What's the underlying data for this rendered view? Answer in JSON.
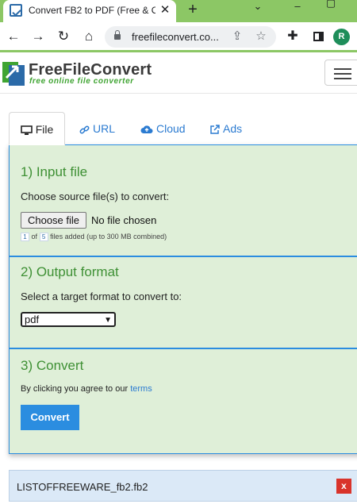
{
  "browser": {
    "tab_title": "Convert FB2 to PDF (Free & O",
    "tab_close_glyph": "✕",
    "new_tab_glyph": "+",
    "url": "freefileconvert.co...",
    "profile_initial": "R",
    "accent_color": "#8cc765"
  },
  "site": {
    "logo_name": "FreeFileConvert",
    "logo_tagline": "free online file converter",
    "menu_icon": "hamburger-icon"
  },
  "upload_tabs": [
    {
      "label": "File",
      "icon": "monitor-icon",
      "active": true
    },
    {
      "label": "URL",
      "icon": "link-icon",
      "active": false
    },
    {
      "label": "Cloud",
      "icon": "cloud-upload-icon",
      "active": false
    },
    {
      "label": "Ads",
      "icon": "external-link-icon",
      "active": false
    }
  ],
  "input_section": {
    "title": "1) Input file",
    "instruction": "Choose source file(s) to convert:",
    "choose_button": "Choose file",
    "no_file_text": "No file chosen",
    "files_added": "1",
    "files_max": "5",
    "files_note": "files added (up to 300 MB combined)",
    "of_word": "of"
  },
  "output_section": {
    "title": "2) Output format",
    "instruction": "Select a target format to convert to:",
    "selected_format": "pdf"
  },
  "convert_section": {
    "title": "3) Convert",
    "agree_text": "By clicking you agree to our",
    "terms_link": "terms",
    "convert_button": "Convert"
  },
  "file_list": [
    {
      "name": "LISTOFFREEWARE_fb2.fb2",
      "remove_label": "x"
    }
  ],
  "colors": {
    "panel_bg": "#dfefd8",
    "panel_border": "#2b8de0",
    "section_title": "#3e9034",
    "link": "#2b7bd1",
    "remove": "#d9342b"
  }
}
